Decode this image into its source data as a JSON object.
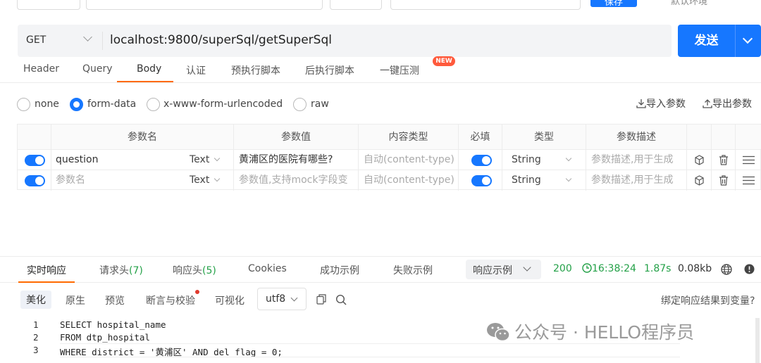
{
  "top": {
    "env_label": "默认环境",
    "save_label": "保存"
  },
  "request": {
    "method": "GET",
    "url": "localhost:9800/superSql/getSuperSql",
    "send_label": "发送"
  },
  "tabs": [
    {
      "label": "Header"
    },
    {
      "label": "Query"
    },
    {
      "label": "Body",
      "active": true
    },
    {
      "label": "认证"
    },
    {
      "label": "预执行脚本"
    },
    {
      "label": "后执行脚本"
    },
    {
      "label": "一键压测",
      "badge": "NEW"
    }
  ],
  "body_types": [
    {
      "label": "none",
      "selected": false
    },
    {
      "label": "form-data",
      "selected": true
    },
    {
      "label": "x-www-form-urlencoded",
      "selected": false
    },
    {
      "label": "raw",
      "selected": false
    }
  ],
  "actions": {
    "import_label": "导入参数",
    "export_label": "导出参数"
  },
  "table": {
    "headers": [
      "参数名",
      "参数值",
      "内容类型",
      "必填",
      "类型",
      "参数描述"
    ],
    "rows": [
      {
        "enabled": true,
        "name": "question",
        "name_is_placeholder": false,
        "field_type": "Text",
        "value": "黄浦区的医院有哪些?",
        "value_is_placeholder": false,
        "content_type": "自动(content-type)",
        "required": true,
        "type": "String",
        "description": "参数描述,用于生成"
      },
      {
        "enabled": true,
        "name": "参数名",
        "name_is_placeholder": true,
        "field_type": "Text",
        "value": "参数值,支持mock字段变",
        "value_is_placeholder": true,
        "content_type": "自动(content-type)",
        "required": true,
        "type": "String",
        "description": "参数描述,用于生成"
      }
    ]
  },
  "response": {
    "tabs": [
      {
        "label": "实时响应",
        "active": true
      },
      {
        "label": "请求头",
        "count": "(7)"
      },
      {
        "label": "响应头",
        "count": "(5)"
      },
      {
        "label": "Cookies"
      },
      {
        "label": "成功示例"
      },
      {
        "label": "失败示例"
      }
    ],
    "example_select": "响应示例",
    "status": "200",
    "time": "16:38:24",
    "duration": "1.87s",
    "size": "0.08kb",
    "sub_tabs": [
      {
        "label": "美化",
        "active": true
      },
      {
        "label": "原生"
      },
      {
        "label": "预览"
      },
      {
        "label": "断言与校验"
      },
      {
        "label": "可视化"
      }
    ],
    "encoding": "utf8",
    "bind_label": "绑定响应结果到变量?",
    "code_lines": [
      {
        "no": "1",
        "text": "SELECT hospital_name"
      },
      {
        "no": "2",
        "text": "FROM dtp_hospital"
      },
      {
        "no": "3",
        "text": "WHERE district = '黄浦区' AND del_flag = 0;"
      }
    ]
  },
  "watermark": "公众号 · HELLO程序员",
  "colors": {
    "primary": "#1677ff",
    "accent": "#ff6a00",
    "success": "#24a148",
    "badge": "#ff5a3c"
  }
}
